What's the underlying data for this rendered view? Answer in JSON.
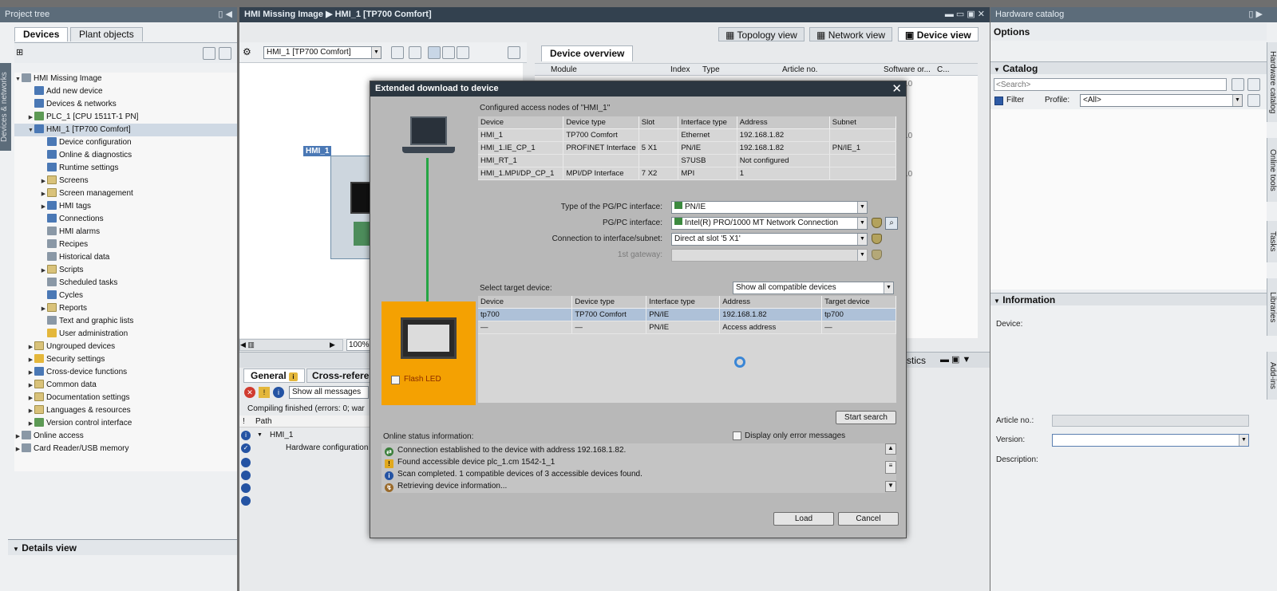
{
  "project_tree": {
    "title": "Project tree",
    "tabs": [
      "Devices",
      "Plant objects"
    ],
    "items": [
      {
        "label": "HMI Missing Image",
        "level": 0,
        "toggle": "▼",
        "icon": "gray"
      },
      {
        "label": "Add new device",
        "level": 1,
        "toggle": "",
        "icon": "blue"
      },
      {
        "label": "Devices & networks",
        "level": 1,
        "toggle": "",
        "icon": "blue"
      },
      {
        "label": "PLC_1 [CPU 1511T-1 PN]",
        "level": 1,
        "toggle": "▶",
        "icon": "green"
      },
      {
        "label": "HMI_1 [TP700 Comfort]",
        "level": 1,
        "toggle": "▼",
        "icon": "blue",
        "selected": true
      },
      {
        "label": "Device configuration",
        "level": 2,
        "toggle": "",
        "icon": "blue"
      },
      {
        "label": "Online & diagnostics",
        "level": 2,
        "toggle": "",
        "icon": "blue"
      },
      {
        "label": "Runtime settings",
        "level": 2,
        "toggle": "",
        "icon": "blue"
      },
      {
        "label": "Screens",
        "level": 2,
        "toggle": "▶",
        "icon": "folder"
      },
      {
        "label": "Screen management",
        "level": 2,
        "toggle": "▶",
        "icon": "folder"
      },
      {
        "label": "HMI tags",
        "level": 2,
        "toggle": "▶",
        "icon": "blue"
      },
      {
        "label": "Connections",
        "level": 2,
        "toggle": "",
        "icon": "blue"
      },
      {
        "label": "HMI alarms",
        "level": 2,
        "toggle": "",
        "icon": "gray"
      },
      {
        "label": "Recipes",
        "level": 2,
        "toggle": "",
        "icon": "gray"
      },
      {
        "label": "Historical data",
        "level": 2,
        "toggle": "",
        "icon": "gray"
      },
      {
        "label": "Scripts",
        "level": 2,
        "toggle": "▶",
        "icon": "folder"
      },
      {
        "label": "Scheduled tasks",
        "level": 2,
        "toggle": "",
        "icon": "gray"
      },
      {
        "label": "Cycles",
        "level": 2,
        "toggle": "",
        "icon": "blue"
      },
      {
        "label": "Reports",
        "level": 2,
        "toggle": "▶",
        "icon": "folder"
      },
      {
        "label": "Text and graphic lists",
        "level": 2,
        "toggle": "",
        "icon": "gray"
      },
      {
        "label": "User administration",
        "level": 2,
        "toggle": "",
        "icon": "yellow"
      },
      {
        "label": "Ungrouped devices",
        "level": 1,
        "toggle": "▶",
        "icon": "folder"
      },
      {
        "label": "Security settings",
        "level": 1,
        "toggle": "▶",
        "icon": "yellow"
      },
      {
        "label": "Cross-device functions",
        "level": 1,
        "toggle": "▶",
        "icon": "blue"
      },
      {
        "label": "Common data",
        "level": 1,
        "toggle": "▶",
        "icon": "folder"
      },
      {
        "label": "Documentation settings",
        "level": 1,
        "toggle": "▶",
        "icon": "folder"
      },
      {
        "label": "Languages & resources",
        "level": 1,
        "toggle": "▶",
        "icon": "folder"
      },
      {
        "label": "Version control interface",
        "level": 1,
        "toggle": "▶",
        "icon": "green"
      },
      {
        "label": "Online access",
        "level": 0,
        "toggle": "▶",
        "icon": "gray"
      },
      {
        "label": "Card Reader/USB memory",
        "level": 0,
        "toggle": "▶",
        "icon": "gray"
      }
    ],
    "details_view": "Details view",
    "side_label": "Devices & networks"
  },
  "editor": {
    "breadcrumb": "HMI Missing Image  ▶  HMI_1 [TP700 Comfort]",
    "view_tabs": [
      "Topology view",
      "Network view",
      "Device view"
    ],
    "device_select": "HMI_1 [TP700 Comfort]",
    "device_label": "HMI_1",
    "zoom": "100%",
    "overview_tab": "Device overview",
    "overview_columns": [
      "Module",
      "Index",
      "Type",
      "Article no.",
      "Software or...",
      "C..."
    ],
    "overview_sw": [
      "16.0.0.0",
      "16.0.0.0",
      "16.0.0.0"
    ],
    "bottom_tabs": [
      "General",
      "Cross-refere"
    ],
    "bottom_right_tab": "stics",
    "messages_filter": "Show all messages",
    "compile_text": "Compiling finished (errors: 0; war",
    "msg_columns": [
      "!",
      "Path"
    ],
    "msg_rows": [
      "HMI_1",
      "Hardware configuration"
    ]
  },
  "dialog": {
    "title": "Extended download to device",
    "configured_caption": "Configured access nodes of \"HMI_1\"",
    "nodes_columns": [
      "Device",
      "Device type",
      "Slot",
      "Interface type",
      "Address",
      "Subnet"
    ],
    "nodes_rows": [
      [
        "HMI_1",
        "TP700 Comfort",
        "",
        "Ethernet",
        "192.168.1.82",
        ""
      ],
      [
        "HMI_1.IE_CP_1",
        "PROFINET Interface",
        "5 X1",
        "PN/IE",
        "192.168.1.82",
        "PN/IE_1"
      ],
      [
        "HMI_RT_1",
        "",
        "",
        "S7USB",
        "Not configured",
        ""
      ],
      [
        "HMI_1.MPI/DP_CP_1",
        "MPI/DP Interface",
        "7 X2",
        "MPI",
        "1",
        ""
      ]
    ],
    "pgpc_type_label": "Type of the PG/PC interface:",
    "pgpc_type_value": "PN/IE",
    "pgpc_label": "PG/PC interface:",
    "pgpc_value": "Intel(R) PRO/1000 MT Network Connection",
    "conn_label": "Connection to interface/subnet:",
    "conn_value": "Direct at slot '5 X1'",
    "gateway_label": "1st gateway:",
    "gateway_value": "",
    "target_label": "Select target device:",
    "target_filter": "Show all compatible devices",
    "target_columns": [
      "Device",
      "Device type",
      "Interface type",
      "Address",
      "Target device"
    ],
    "target_rows": [
      [
        "tp700",
        "TP700 Comfort",
        "PN/IE",
        "192.168.1.82",
        "tp700"
      ],
      [
        "—",
        "—",
        "PN/IE",
        "Access address",
        "—"
      ]
    ],
    "flash_led": "Flash LED",
    "start_search": "Start search",
    "status_caption": "Online status information:",
    "only_errors": "Display only error messages",
    "status_rows": [
      {
        "icon": "link",
        "text": "Connection established to the device with address 192.168.1.82."
      },
      {
        "icon": "warning",
        "text": "Found accessible device plc_1.cm 1542-1_1"
      },
      {
        "icon": "info",
        "text": "Scan completed. 1 compatible devices of 3 accessible devices found."
      },
      {
        "icon": "retrieve",
        "text": "Retrieving device information..."
      }
    ],
    "load_button": "Load",
    "cancel_button": "Cancel"
  },
  "hardware_catalog": {
    "title": "Hardware catalog",
    "options": "Options",
    "catalog": "Catalog",
    "search_placeholder": "<Search>",
    "filter": "Filter",
    "profile_label": "Profile:",
    "profile_value": "<All>",
    "information": "Information",
    "device_label": "Device:",
    "article_label": "Article no.:",
    "version_label": "Version:",
    "description_label": "Description:",
    "side_tabs": [
      "Hardware catalog",
      "Online tools",
      "Tasks",
      "Libraries",
      "Add-ins"
    ]
  }
}
